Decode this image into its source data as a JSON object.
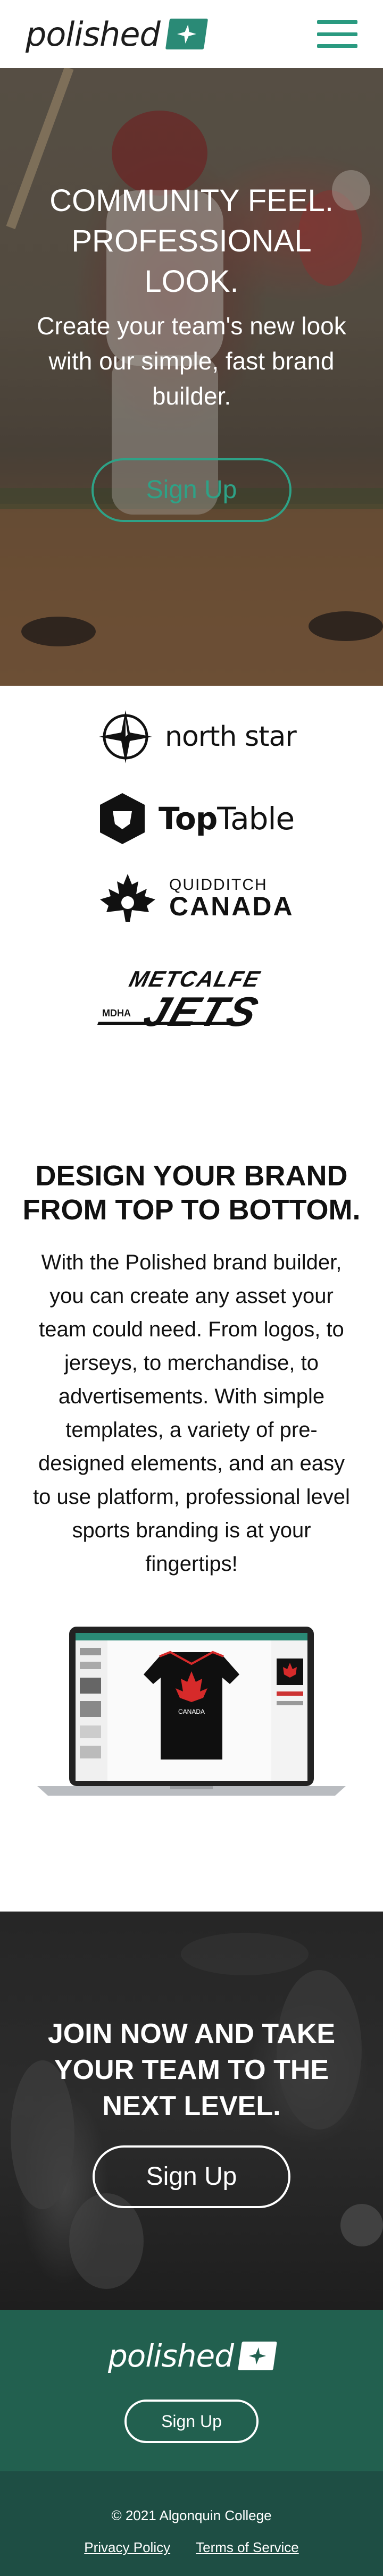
{
  "header": {
    "logo_text": "polished",
    "menu_icon": "hamburger-menu-icon"
  },
  "hero": {
    "title": "COMMUNITY FEEL. PROFESSIONAL LOOK.",
    "subtitle": "Create your team's new look with our simple, fast brand builder.",
    "cta_label": "Sign Up"
  },
  "partners": [
    {
      "name": "north star",
      "icon": "north-star-compass-icon"
    },
    {
      "name_bold": "Top",
      "name_rest": "Table",
      "icon": "toptable-shield-icon"
    },
    {
      "line1": "QUIDDITCH",
      "line2": "CANADA",
      "icon": "maple-leaf-icon"
    },
    {
      "line1": "METCALFE",
      "line2": "JETS",
      "tag": "MDHA"
    }
  ],
  "design": {
    "title": "DESIGN YOUR BRAND FROM TOP TO BOTTOM.",
    "body": "With the Polished brand builder, you can create any asset your team could need. From logos, to jerseys, to merchandise, to advertisements. With simple templates, a variety of pre-designed elements, and an easy to use platform, professional level sports branding is at your fingertips!",
    "jersey_text": "CANADA"
  },
  "join": {
    "title": "JOIN NOW AND TAKE YOUR TEAM TO THE NEXT LEVEL.",
    "cta_label": "Sign Up"
  },
  "footer": {
    "logo_text": "polished",
    "cta_label": "Sign Up",
    "copyright": "© 2021 Algonquin College",
    "links": [
      "Privacy Policy",
      "Terms of Service"
    ]
  },
  "colors": {
    "brand_green": "#2a8a76",
    "footer_green": "#22604f",
    "footer_dark": "#1e4e44"
  }
}
